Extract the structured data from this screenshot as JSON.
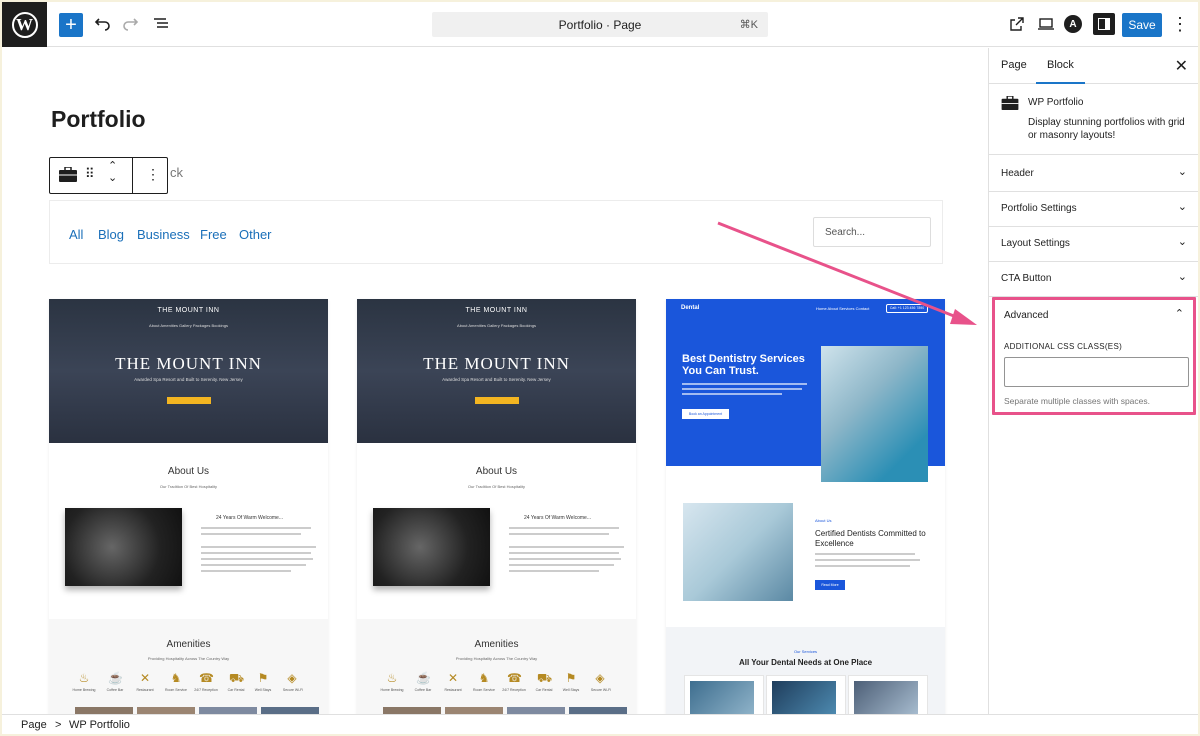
{
  "topbar": {
    "command_title": "Portfolio · Page",
    "command_shortcut": "⌘K",
    "save_label": "Save"
  },
  "editor": {
    "page_title": "Portfolio",
    "ghost_text": "ck",
    "filters": [
      "All",
      "Blog",
      "Business",
      "Free",
      "Other"
    ],
    "search_placeholder": "Search..."
  },
  "cards": {
    "inn": {
      "logo": "THE MOUNT INN",
      "nav": "About   Amenities   Gallery   Packages   Bookings",
      "title": "THE MOUNT INN",
      "subtitle": "Awarded Spa Resort and Built to Serenity. New Jersey",
      "about_heading": "About Us",
      "about_tagline": "Our Tradition Of Best Hospitality",
      "about_right_heading": "24 Years Of Warm Welcome...",
      "amenities_heading": "Amenities",
      "amenities_tagline": "Providing Hospitality Across The Country Way",
      "amenities": [
        "Home Brewing",
        "Coffee Bar",
        "Restaurant",
        "Room Service",
        "24/7 Reception",
        "Car Rental",
        "Well Stays",
        "Secure Wi-Fi"
      ]
    },
    "dental": {
      "logo": "Dental",
      "nav": "Home    About    Services    Contact",
      "nav_button": "Call: +1 123 456 7890",
      "hero_title": "Best Dentistry Services You Can Trust.",
      "hero_button": "Book an Appointment",
      "eyebrow": "About Us",
      "heading": "Certified Dentists Committed to Excellence",
      "read_more": "Read More",
      "services_eyebrow": "Our Services",
      "services_heading": "All Your Dental Needs at One Place"
    }
  },
  "sidebar": {
    "tabs": [
      "Page",
      "Block"
    ],
    "active_tab": "Block",
    "block_title": "WP Portfolio",
    "block_description": "Display stunning portfolios with grid or masonry layouts!",
    "panels": [
      "Header",
      "Portfolio Settings",
      "Layout Settings",
      "CTA Button"
    ],
    "advanced": {
      "title": "Advanced",
      "css_label": "ADDITIONAL CSS CLASS(ES)",
      "css_value": "",
      "help": "Separate multiple classes with spaces."
    }
  },
  "breadcrumb": {
    "items": [
      "Page",
      "WP Portfolio"
    ],
    "separator": ">"
  },
  "colors": {
    "accent": "#1a75c8",
    "highlight": "#e8528a",
    "amenity_icon": "#b58a23"
  }
}
